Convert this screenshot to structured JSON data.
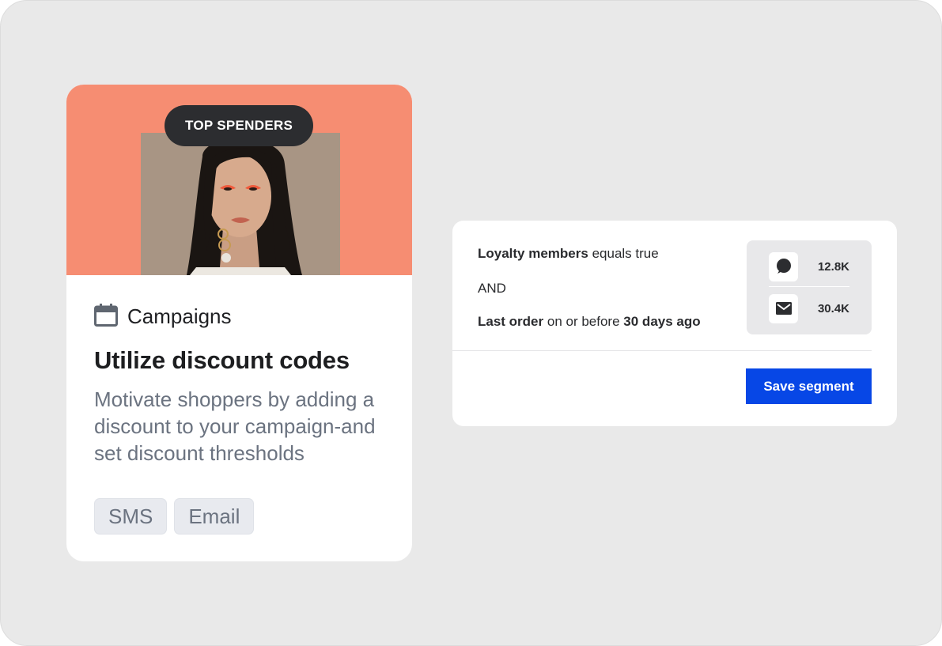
{
  "campaign_card": {
    "badge": "TOP SPENDERS",
    "category": "Campaigns",
    "title": "Utilize discount codes",
    "description": "Motivate shoppers by adding a discount to your campaign-and set discount thresholds",
    "tags": [
      "SMS",
      "Email"
    ],
    "hero_color": "#f68d72"
  },
  "segment": {
    "rule1": {
      "field": "Loyalty members",
      "operator": "equals true"
    },
    "conjunction": "AND",
    "rule2": {
      "field": "Last order",
      "operator": "on or before",
      "value": "30 days ago"
    },
    "stats": [
      {
        "icon": "chat-bubble-icon",
        "value": "12.8K"
      },
      {
        "icon": "envelope-icon",
        "value": "30.4K"
      }
    ],
    "save_label": "Save segment",
    "accent_color": "#0747e6"
  }
}
